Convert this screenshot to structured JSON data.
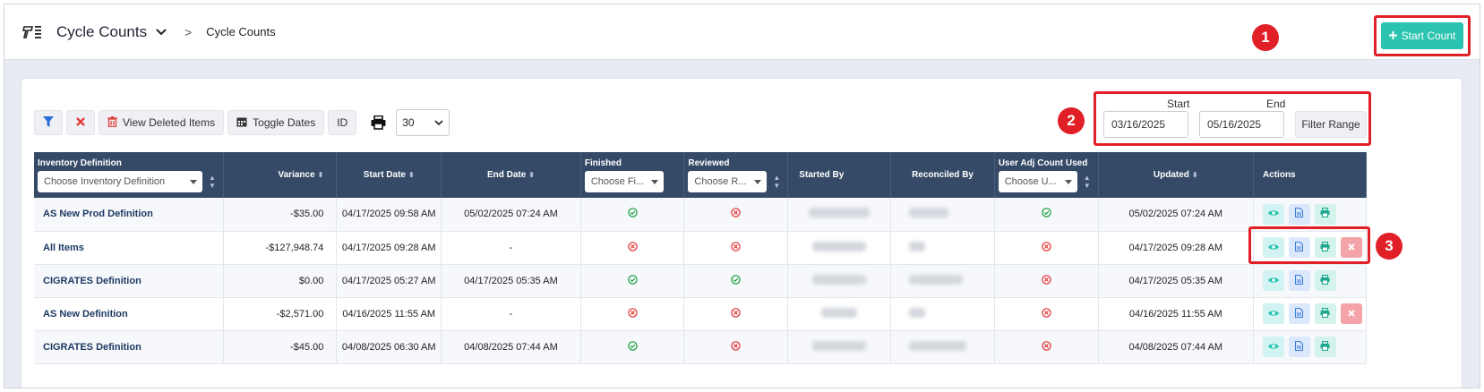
{
  "header": {
    "title": "Cycle Counts",
    "breadcrumb_sep": ">",
    "breadcrumb_current": "Cycle Counts",
    "start_count_label": "Start Count"
  },
  "annotations": [
    "1",
    "2",
    "3"
  ],
  "toolbar": {
    "view_deleted_label": "View Deleted Items",
    "toggle_dates_label": "Toggle Dates",
    "id_label": "ID",
    "page_size": "30"
  },
  "date_range": {
    "start_label": "Start",
    "end_label": "End",
    "start_value": "03/16/2025",
    "end_value": "05/16/2025",
    "filter_label": "Filter Range"
  },
  "table": {
    "columns": {
      "inventory_definition": "Inventory Definition",
      "inventory_placeholder": "Choose Inventory Definition",
      "variance": "Variance",
      "start_date": "Start Date",
      "end_date": "End Date",
      "finished": "Finished",
      "finished_placeholder": "Choose Fi...",
      "reviewed": "Reviewed",
      "reviewed_placeholder": "Choose R...",
      "started_by": "Started By",
      "reconciled_by": "Reconciled By",
      "user_adj": "User Adj Count Used",
      "user_adj_placeholder": "Choose U...",
      "updated": "Updated",
      "actions": "Actions"
    },
    "rows": [
      {
        "name": "AS New Prod Definition",
        "variance": "-$35.00",
        "start": "04/17/2025 09:58 AM",
        "end": "05/02/2025 07:24 AM",
        "finished": true,
        "reviewed": false,
        "adj": true,
        "updated": "05/02/2025 07:24 AM",
        "deletable": false
      },
      {
        "name": "All Items",
        "variance": "-$127,948.74",
        "start": "04/17/2025 09:28 AM",
        "end": "-",
        "finished": false,
        "reviewed": false,
        "adj": false,
        "updated": "04/17/2025 09:28 AM",
        "deletable": true
      },
      {
        "name": "CIGRATES Definition",
        "variance": "$0.00",
        "start": "04/17/2025 05:27 AM",
        "end": "04/17/2025 05:35 AM",
        "finished": true,
        "reviewed": true,
        "adj": false,
        "updated": "04/17/2025 05:35 AM",
        "deletable": false
      },
      {
        "name": "AS New Definition",
        "variance": "-$2,571.00",
        "start": "04/16/2025 11:55 AM",
        "end": "-",
        "finished": false,
        "reviewed": false,
        "adj": false,
        "updated": "04/16/2025 11:55 AM",
        "deletable": true
      },
      {
        "name": "CIGRATES Definition",
        "variance": "-$45.00",
        "start": "04/08/2025 06:30 AM",
        "end": "04/08/2025 07:44 AM",
        "finished": true,
        "reviewed": false,
        "adj": false,
        "updated": "04/08/2025 07:44 AM",
        "deletable": false
      }
    ]
  },
  "colors": {
    "accent": "#2bc4b0",
    "header_bg": "#344a67",
    "highlight": "#e01f26",
    "ok": "#23a347",
    "bad": "#e33e3e"
  }
}
